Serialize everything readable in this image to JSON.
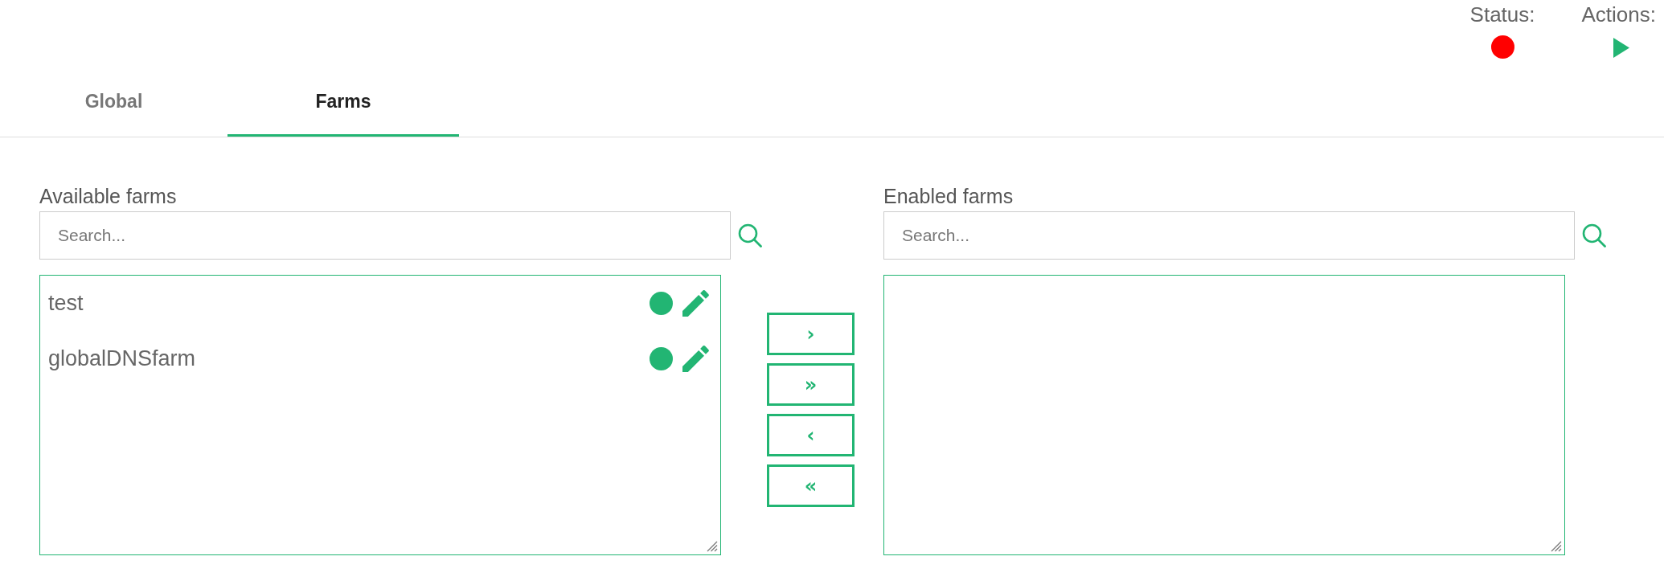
{
  "header": {
    "status": {
      "label": "Status:",
      "color": "#ff0000"
    },
    "actions": {
      "label": "Actions:"
    }
  },
  "tabs": [
    {
      "label": "Global",
      "selected": false
    },
    {
      "label": "Farms",
      "selected": true
    }
  ],
  "available_farms": {
    "title": "Available farms",
    "search": {
      "placeholder": "Search..."
    },
    "items": [
      {
        "name": "test",
        "color": "#22b573",
        "selected": false
      },
      {
        "name": "globalDNSfarm",
        "color": "#22b573",
        "selected": false
      }
    ]
  },
  "transfer_buttons": [
    {
      "label": "›"
    },
    {
      "label": "»"
    },
    {
      "label": "‹"
    },
    {
      "label": "«"
    }
  ],
  "enabled_farms": {
    "title": "Enabled farms",
    "search": {
      "placeholder": "Search..."
    }
  }
}
